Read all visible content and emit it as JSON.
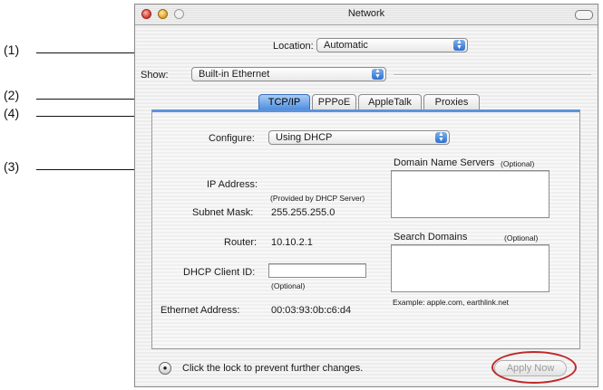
{
  "callouts": [
    "(1)",
    "(2)",
    "(4)",
    "(3)"
  ],
  "window": {
    "title": "Network"
  },
  "location": {
    "label": "Location:",
    "value": "Automatic"
  },
  "show": {
    "label": "Show:",
    "value": "Built-in Ethernet"
  },
  "tabs": [
    {
      "label": "TCP/IP",
      "selected": true
    },
    {
      "label": "PPPoE",
      "selected": false
    },
    {
      "label": "AppleTalk",
      "selected": false
    },
    {
      "label": "Proxies",
      "selected": false
    }
  ],
  "configure": {
    "label": "Configure:",
    "value": "Using DHCP"
  },
  "ip_address": {
    "label": "IP Address:",
    "note": "(Provided by DHCP Server)"
  },
  "subnet_mask": {
    "label": "Subnet Mask:",
    "value": "255.255.255.0"
  },
  "router": {
    "label": "Router:",
    "value": "10.10.2.1"
  },
  "dhcp_client_id": {
    "label": "DHCP Client ID:",
    "value": "",
    "note": "(Optional)"
  },
  "ethernet_address": {
    "label": "Ethernet Address:",
    "value": "00:03:93:0b:c6:d4"
  },
  "dns": {
    "label": "Domain Name Servers",
    "optional": "(Optional)",
    "value": ""
  },
  "search_domains": {
    "label": "Search Domains",
    "optional": "(Optional)",
    "value": "",
    "example": "Example: apple.com, earthlink.net"
  },
  "footer": {
    "lock_text": "Click the lock to prevent further changes.",
    "apply_label": "Apply Now"
  },
  "colors": {
    "active_tab": "#4f8ee0",
    "popup_arrows": "#2f6fcf",
    "highlight_ellipse": "#c0282b"
  },
  "icons": [
    "close-button-icon",
    "minimize-button-icon",
    "zoom-button-icon",
    "popup-arrows-icon",
    "lock-icon"
  ]
}
